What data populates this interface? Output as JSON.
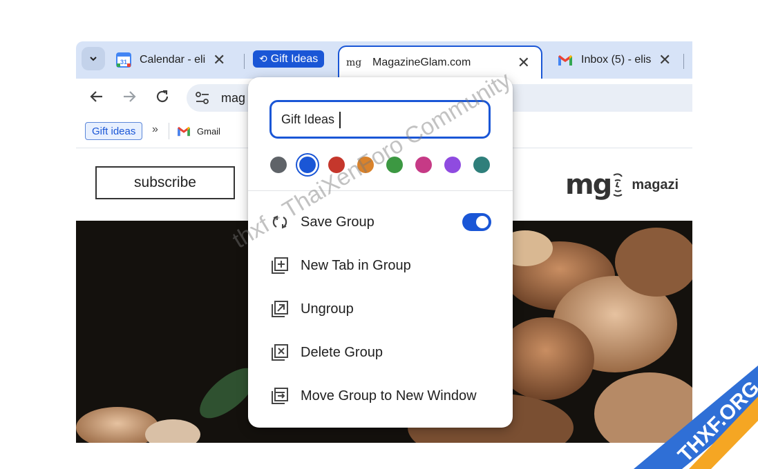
{
  "tabs": {
    "calendar": {
      "title": "Calendar - eli",
      "icon": "google-calendar-icon",
      "icon_text": "31"
    },
    "group_chip": {
      "label": "Gift Ideas",
      "color": "#1a56d6"
    },
    "active": {
      "title": "MagazineGlam.com",
      "icon_text": "mg"
    },
    "inbox": {
      "title": "Inbox (5) - elis",
      "icon": "gmail-icon"
    }
  },
  "toolbar": {
    "url": "mag"
  },
  "bookmarks": {
    "group": "Gift ideas",
    "more": "»",
    "gmail": "Gmail"
  },
  "page": {
    "subscribe": "subscribe",
    "logo_mark": "mg",
    "site_name": "magazi"
  },
  "group_editor": {
    "name_value": "Gift Ideas",
    "colors": [
      "#5f6368",
      "#1a56d6",
      "#c5372c",
      "#d9822b",
      "#3c9842",
      "#c63a86",
      "#8f4be0",
      "#2f7f7b"
    ],
    "selected_color_index": 1,
    "menu": {
      "save": "Save Group",
      "new_tab": "New Tab in Group",
      "ungroup": "Ungroup",
      "delete": "Delete Group",
      "move": "Move Group to New Window"
    },
    "save_enabled": true
  },
  "watermark": {
    "text": "thxf - ThaiXenForo Community",
    "badge": "THXF.ORG"
  }
}
